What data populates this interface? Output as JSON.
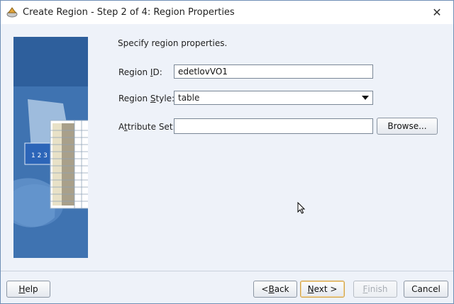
{
  "window": {
    "title": "Create Region - Step 2 of 4: Region Properties",
    "close_glyph": "✕"
  },
  "main": {
    "prompt": "Specify region properties.",
    "region_id": {
      "label_pre": "Region ",
      "label_key": "I",
      "label_post": "D:",
      "value": "edetlovVO1"
    },
    "region_style": {
      "label_pre": "Region ",
      "label_key": "S",
      "label_post": "tyle:",
      "value": "table"
    },
    "attribute_set": {
      "label_pre": "A",
      "label_key": "t",
      "label_post": "tribute Set:",
      "value": "",
      "browse_label": "Browse..."
    }
  },
  "footer": {
    "help_label_key": "H",
    "help_label_rest": "elp",
    "back_label_pre": "< ",
    "back_label_key": "B",
    "back_label_rest": "ack",
    "next_label_pre": "",
    "next_label_key": "N",
    "next_label_rest": "ext >",
    "finish_label_key": "F",
    "finish_label_rest": "inish",
    "cancel_label": "Cancel"
  },
  "icons": {
    "app": "wizard-icon",
    "close": "close-icon",
    "cursor": "mouse-pointer-icon"
  }
}
